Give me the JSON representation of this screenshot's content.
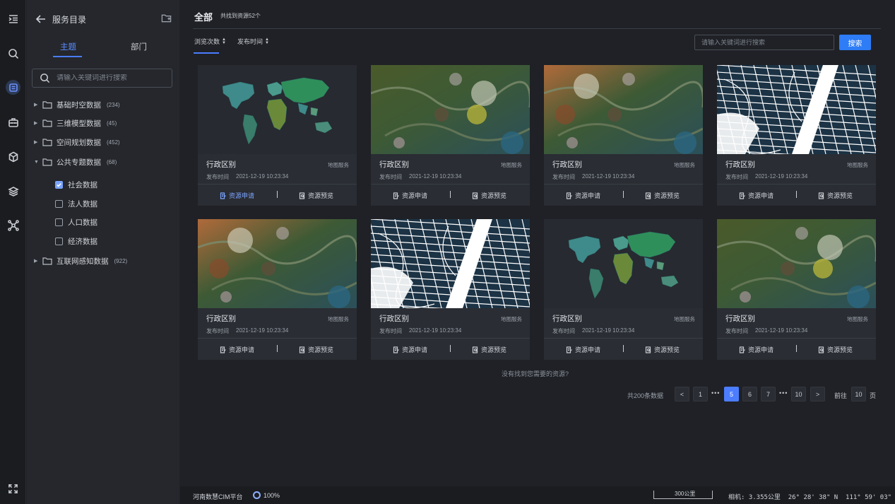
{
  "rail": {
    "items": [
      {
        "icon": "menu-indent-icon"
      },
      {
        "icon": "search-icon"
      },
      {
        "icon": "catalog-icon",
        "active": true
      },
      {
        "icon": "toolbox-icon"
      },
      {
        "icon": "cube-icon"
      },
      {
        "icon": "layers-icon"
      },
      {
        "icon": "network-icon"
      }
    ],
    "bottom_icon": "fullscreen-icon"
  },
  "sidebar": {
    "title": "服务目录",
    "tabs": [
      {
        "label": "主题",
        "active": true
      },
      {
        "label": "部门",
        "active": false
      }
    ],
    "search_placeholder": "请输入关键词进行搜索",
    "tree": [
      {
        "label": "基础时空数据",
        "count": "(234)",
        "expanded": false
      },
      {
        "label": "三维模型数据",
        "count": "(45)",
        "expanded": false
      },
      {
        "label": "空间规划数据",
        "count": "(452)",
        "expanded": false
      },
      {
        "label": "公共专题数据",
        "count": "(68)",
        "expanded": true
      },
      {
        "label": "互联网感知数据",
        "count": "(922)",
        "expanded": false
      }
    ],
    "leaves": [
      {
        "label": "社会数据",
        "checked": true
      },
      {
        "label": "法人数据",
        "checked": false
      },
      {
        "label": "人口数据",
        "checked": false
      },
      {
        "label": "经济数据",
        "checked": false
      }
    ]
  },
  "main": {
    "title": "全部",
    "found": "共找到资源52个",
    "sort": [
      "浏览次数",
      "发布时间"
    ],
    "search_placeholder": "请输入关键词进行搜索",
    "search_btn": "搜索",
    "cards": [
      {
        "title": "行政区别",
        "type": "地图服务",
        "date_label": "发布时间",
        "date": "2021-12-19 10:23:34",
        "apply": "资源申请",
        "preview": "资源预览",
        "thumb": "world",
        "apply_active": true
      },
      {
        "title": "行政区别",
        "type": "地图服务",
        "date_label": "发布时间",
        "date": "2021-12-19 10:23:34",
        "apply": "资源申请",
        "preview": "资源预览",
        "thumb": "terrain-a"
      },
      {
        "title": "行政区别",
        "type": "地图服务",
        "date_label": "发布时间",
        "date": "2021-12-19 10:23:34",
        "apply": "资源申请",
        "preview": "资源预览",
        "thumb": "terrain-b"
      },
      {
        "title": "行政区别",
        "type": "地图服务",
        "date_label": "发布时间",
        "date": "2021-12-19 10:23:34",
        "apply": "资源申请",
        "preview": "资源预览",
        "thumb": "street"
      },
      {
        "title": "行政区别",
        "type": "地图服务",
        "date_label": "发布时间",
        "date": "2021-12-19 10:23:34",
        "apply": "资源申请",
        "preview": "资源预览",
        "thumb": "terrain-b"
      },
      {
        "title": "行政区别",
        "type": "地图服务",
        "date_label": "发布时间",
        "date": "2021-12-19 10:23:34",
        "apply": "资源申请",
        "preview": "资源预览",
        "thumb": "street"
      },
      {
        "title": "行政区别",
        "type": "地图服务",
        "date_label": "发布时间",
        "date": "2021-12-19 10:23:34",
        "apply": "资源申请",
        "preview": "资源预览",
        "thumb": "world"
      },
      {
        "title": "行政区别",
        "type": "地图服务",
        "date_label": "发布时间",
        "date": "2021-12-19 10:23:34",
        "apply": "资源申请",
        "preview": "资源预览",
        "thumb": "terrain-a"
      }
    ],
    "no_result": "没有找到您需要的资源?",
    "pagination": {
      "total": "共200条数据",
      "prev": "<",
      "next": ">",
      "pages": [
        "1",
        "5",
        "6",
        "7",
        "10"
      ],
      "current": "5",
      "goto_label": "前往",
      "goto_value": "10",
      "goto_suffix": "页"
    }
  },
  "status": {
    "platform": "河南数慧CIM平台",
    "progress": "100%",
    "scale": "300公里",
    "camera": "相机: 3.355公里  26° 28' 38\" N  111° 59' 03\" E"
  }
}
